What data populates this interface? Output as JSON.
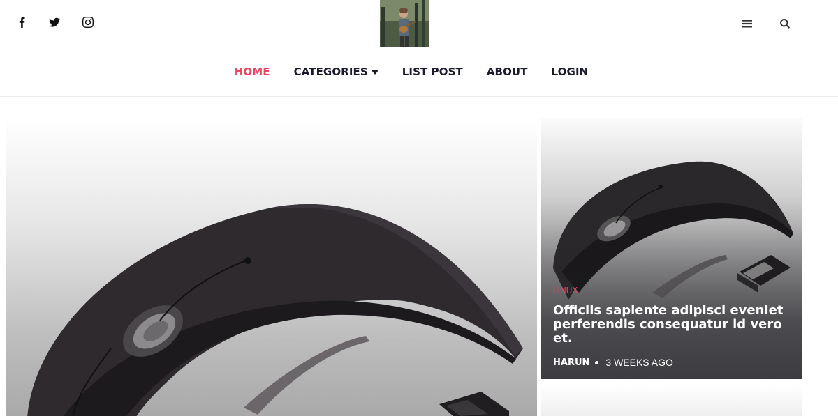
{
  "header": {
    "social": [
      {
        "icon": "facebook-icon",
        "label": "Facebook"
      },
      {
        "icon": "twitter-icon",
        "label": "Twitter"
      },
      {
        "icon": "instagram-icon",
        "label": "Instagram"
      }
    ],
    "logo_alt": "Site logo",
    "actions": [
      {
        "icon": "menu-icon"
      },
      {
        "icon": "search-icon"
      }
    ]
  },
  "nav": {
    "items": [
      {
        "label": "HOME",
        "active": true
      },
      {
        "label": "CATEGORIES",
        "has_dropdown": true
      },
      {
        "label": "LIST POST"
      },
      {
        "label": "ABOUT"
      },
      {
        "label": "LOGIN"
      }
    ]
  },
  "featured": {
    "side_post": {
      "category": "LINUX",
      "title": "Officiis sapiente adipisci eveniet perferendis consequatur id vero et.",
      "author": "HARUN",
      "time": "3 WEEKS AGO"
    }
  },
  "colors": {
    "accent": "#e8475f",
    "nav_text": "#1a1a2e",
    "border": "#ececec"
  }
}
